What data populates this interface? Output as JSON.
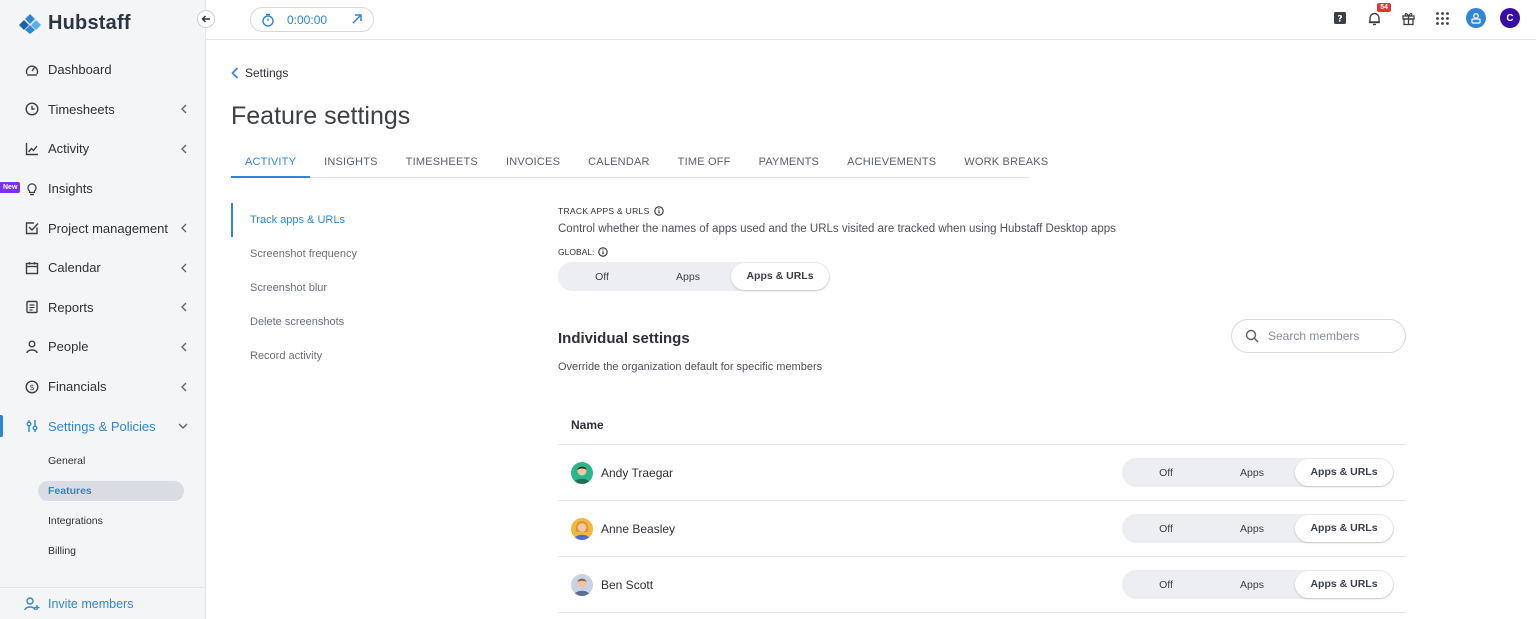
{
  "app": {
    "name": "Hubstaff"
  },
  "colors": {
    "accent": "#2f86d6",
    "badge_new": "#7a2ff5",
    "notification": "#e0392b",
    "user_avatar": "#3a0ca3"
  },
  "topbar": {
    "timer_value": "0:00:00",
    "notification_count": "54",
    "user_initial": "C",
    "icons": [
      "help-icon",
      "bell-icon",
      "gift-icon",
      "apps-grid-icon",
      "account-icon"
    ]
  },
  "sidebar": {
    "new_badge": "New",
    "items": [
      {
        "label": "Dashboard",
        "icon": "dashboard-icon"
      },
      {
        "label": "Timesheets",
        "icon": "clock-icon"
      },
      {
        "label": "Activity",
        "icon": "activity-chart-icon"
      },
      {
        "label": "Insights",
        "icon": "lightbulb-icon"
      },
      {
        "label": "Project management",
        "icon": "checkbox-icon"
      },
      {
        "label": "Calendar",
        "icon": "calendar-icon"
      },
      {
        "label": "Reports",
        "icon": "report-icon"
      },
      {
        "label": "People",
        "icon": "person-icon"
      },
      {
        "label": "Financials",
        "icon": "dollar-icon"
      },
      {
        "label": "Settings & Policies",
        "icon": "settings-sliders-icon"
      }
    ],
    "subitems": [
      "General",
      "Features",
      "Integrations",
      "Billing"
    ],
    "invite_label": "Invite members"
  },
  "main": {
    "breadcrumb": "Settings",
    "title": "Feature settings",
    "tabs": [
      "ACTIVITY",
      "INSIGHTS",
      "TIMESHEETS",
      "INVOICES",
      "CALENDAR",
      "TIME OFF",
      "PAYMENTS",
      "ACHIEVEMENTS",
      "WORK BREAKS"
    ],
    "subnav": [
      "Track apps & URLs",
      "Screenshot frequency",
      "Screenshot blur",
      "Delete screenshots",
      "Record activity"
    ],
    "section": {
      "label": "TRACK APPS & URLS",
      "description": "Control whether the names of apps used and the URLs visited are tracked when using Hubstaff Desktop apps",
      "global_label": "GLOBAL:",
      "options": [
        "Off",
        "Apps",
        "Apps & URLs"
      ],
      "global_selected": "Apps & URLs"
    },
    "individual": {
      "title": "Individual settings",
      "description": "Override the organization default for specific members",
      "search_placeholder": "Search members",
      "column_name": "Name",
      "members": [
        {
          "name": "Andy Traegar",
          "selected": "Apps & URLs"
        },
        {
          "name": "Anne Beasley",
          "selected": "Apps & URLs"
        },
        {
          "name": "Ben Scott",
          "selected": "Apps & URLs"
        }
      ]
    }
  }
}
